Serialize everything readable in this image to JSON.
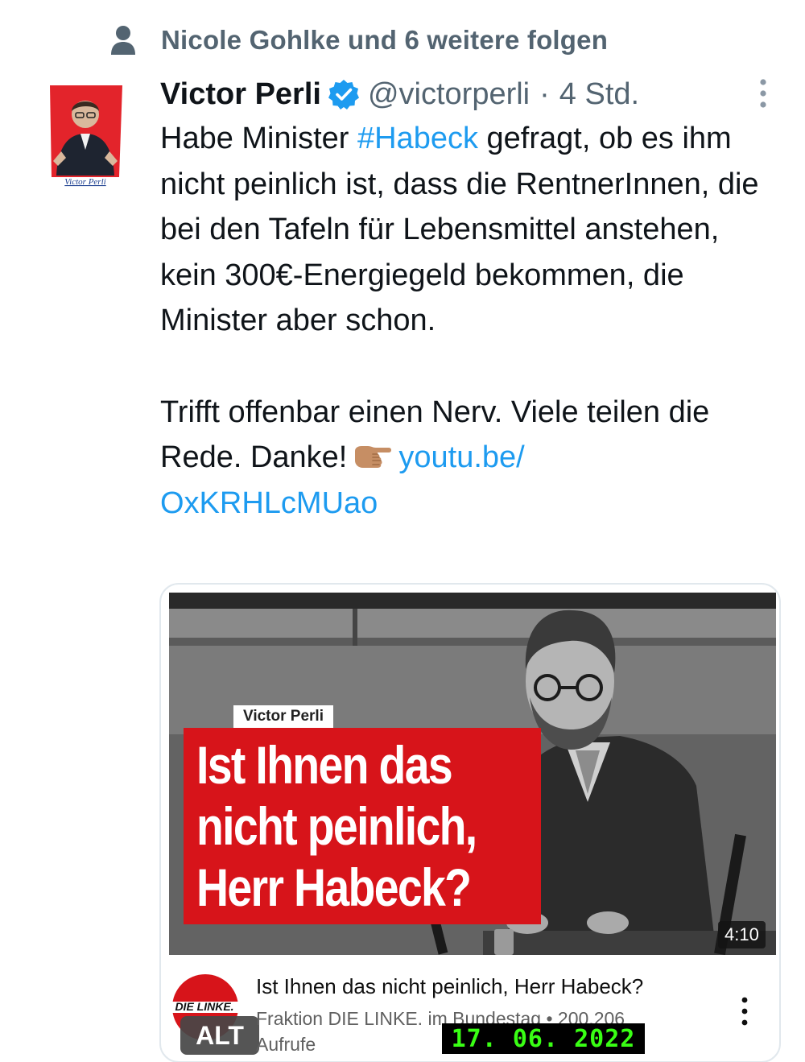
{
  "social_context": {
    "icon": "person-icon",
    "text": "Nicole Gohlke und 6 weitere folgen"
  },
  "tweet": {
    "avatar_caption": "Victor Perli",
    "author_name": "Victor Perli",
    "verified": true,
    "handle": "@victorperli",
    "separator": "·",
    "timestamp": "4 Std.",
    "body_part1": "Habe Minister ",
    "hashtag": "#Habeck",
    "body_part2": " gefragt, ob es ihm nicht peinlich ist, dass die RentnerInnen, die bei den Tafeln für Lebensmittel anstehen, kein 300€-Energiegeld bekommen, die Minister aber schon.",
    "body_part3": "Trifft offenbar einen Nerv. Viele teilen die Rede. Danke!",
    "link_line1": "youtu.be/",
    "link_line2": "OxKRHLcMUao"
  },
  "video_card": {
    "thumbnail_name_tag": "Victor Perli",
    "thumbnail_headline": [
      "Ist Ihnen das",
      "nicht peinlich,",
      "Herr Habeck?"
    ],
    "duration": "4:10",
    "title": "Ist Ihnen das nicht peinlich, Herr Habeck?",
    "channel_line": "Fraktion DIE LINKE. im Bundestag • 200.206",
    "views_line": "Aufrufe",
    "channel_logo_text": "DIE LINKE.",
    "alt_badge": "ALT"
  },
  "overlay": {
    "date_stamp": "17. 06. 2022"
  },
  "colors": {
    "link_blue": "#1d9bf0",
    "verified_blue": "#1d9bf0",
    "secondary_text": "#536471",
    "headline_red": "#d7141a",
    "stamp_green": "#39ff14"
  }
}
